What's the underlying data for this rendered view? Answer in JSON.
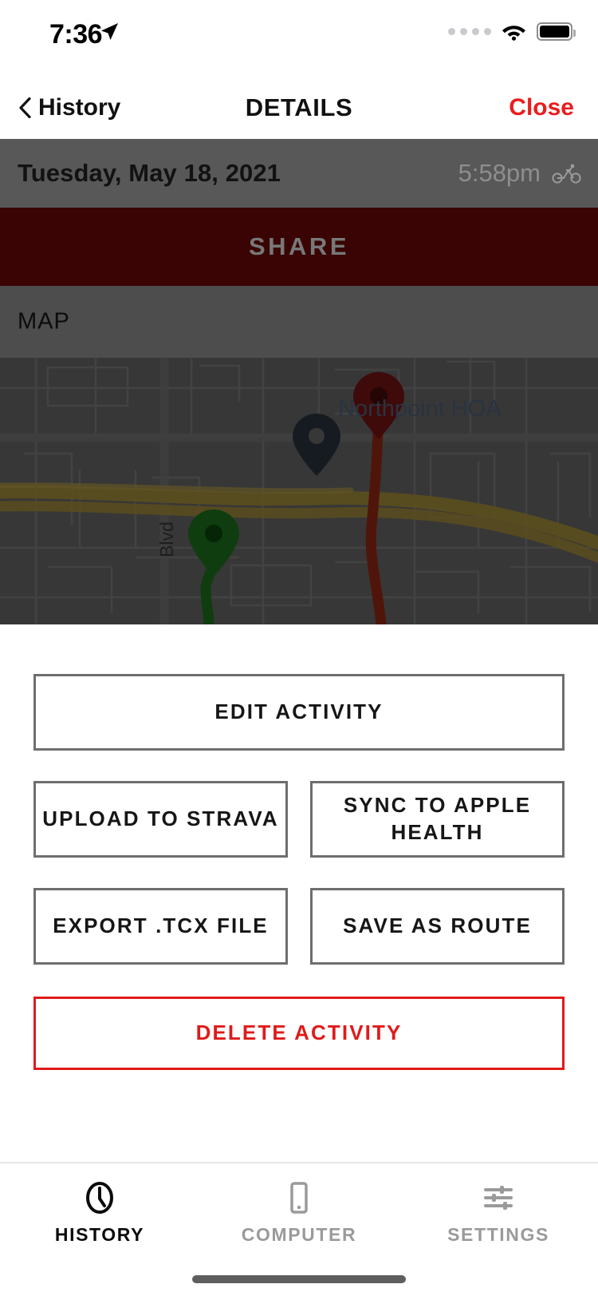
{
  "status_bar": {
    "time": "7:36",
    "location_icon": "location-arrow-icon",
    "cellular_icon": "cellular-dots-icon",
    "wifi_icon": "wifi-icon",
    "battery_icon": "battery-full-icon"
  },
  "nav": {
    "back_label": "History",
    "back_icon": "chevron-left-icon",
    "title": "DETAILS",
    "close_label": "Close",
    "close_color": "#ea1d1d"
  },
  "activity": {
    "date": "Tuesday, May 18, 2021",
    "time": "5:58pm",
    "type_icon": "bicycle-icon"
  },
  "share": {
    "label": "SHARE",
    "background": "#3a0404"
  },
  "map": {
    "section_label": "MAP",
    "poi_label": "Northpoint HOA",
    "street_label": "Blvd",
    "start_marker": "green-start-pin",
    "end_marker": "red-end-pin",
    "poi_marker": "gray-poi-pin",
    "route_color": "#9e2b16",
    "start_color": "#1f7a1f"
  },
  "actions": {
    "edit": "EDIT ACTIVITY",
    "strava": "UPLOAD TO STRAVA",
    "apple_health": "SYNC TO APPLE HEALTH",
    "export": "EXPORT .TCX FILE",
    "save_route": "SAVE AS ROUTE",
    "delete": "DELETE ACTIVITY",
    "delete_color": "#e01a1a"
  },
  "tabs": [
    {
      "label": "HISTORY",
      "icon": "clock-icon",
      "active": true
    },
    {
      "label": "COMPUTER",
      "icon": "phone-icon",
      "active": false
    },
    {
      "label": "SETTINGS",
      "icon": "sliders-icon",
      "active": false
    }
  ]
}
